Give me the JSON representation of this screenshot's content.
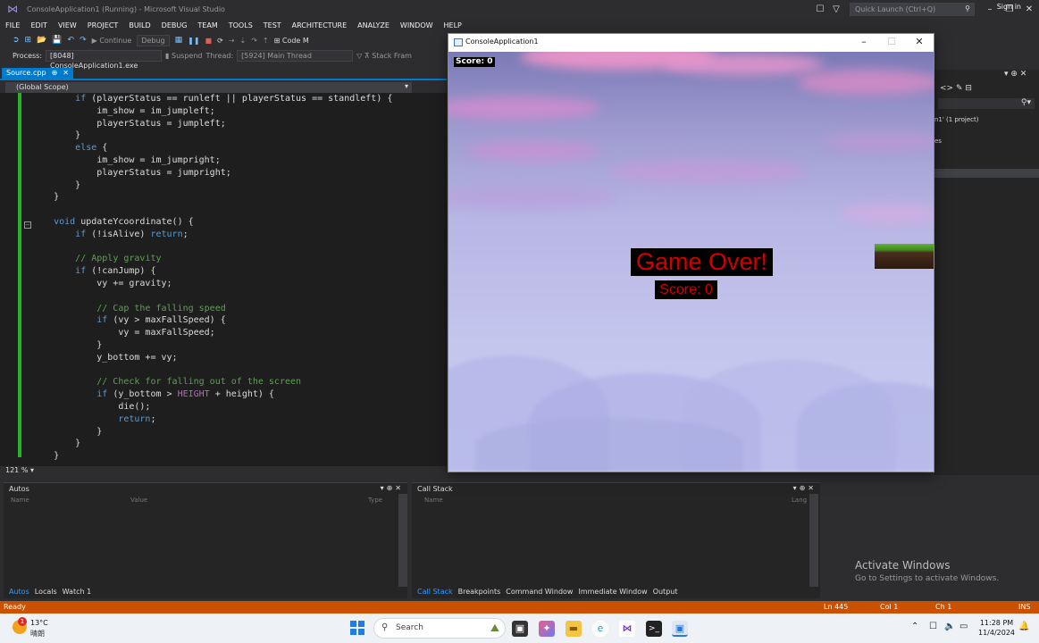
{
  "vs": {
    "title": "ConsoleApplication1 (Running) - Microsoft Visual Studio",
    "quick_launch_placeholder": "Quick Launch (Ctrl+Q)",
    "sign_in": "Sign in",
    "menu": [
      "FILE",
      "EDIT",
      "VIEW",
      "PROJECT",
      "BUILD",
      "DEBUG",
      "TEAM",
      "TOOLS",
      "TEST",
      "ARCHITECTURE",
      "ANALYZE",
      "WINDOW",
      "HELP"
    ],
    "toolbar": {
      "continue_label": "Continue",
      "config": "Debug",
      "code_map": "Code M"
    },
    "toolbar2": {
      "process_label": "Process:",
      "process_value": "[8048] ConsoleApplication1.exe",
      "suspend_label": "Suspend",
      "thread_label": "Thread:",
      "thread_value": "[5924] Main Thread",
      "stack_frame": "Stack Fram"
    },
    "doc_tab": "Source.cpp",
    "scope": "(Global Scope)",
    "zoom": "121 %"
  },
  "code_lines": [
    [
      {
        "t": "        "
      },
      {
        "t": "if",
        "c": "kw"
      },
      {
        "t": " (playerStatus == runleft || playerStatus == standleft) {"
      }
    ],
    [
      {
        "t": "            im_show = im_jumpleft;"
      }
    ],
    [
      {
        "t": "            playerStatus = jumpleft;"
      }
    ],
    [
      {
        "t": "        }"
      }
    ],
    [
      {
        "t": "        "
      },
      {
        "t": "else",
        "c": "kw"
      },
      {
        "t": " {"
      }
    ],
    [
      {
        "t": "            im_show = im_jumpright;"
      }
    ],
    [
      {
        "t": "            playerStatus = jumpright;"
      }
    ],
    [
      {
        "t": "        }"
      }
    ],
    [
      {
        "t": "    }"
      }
    ],
    [
      {
        "t": ""
      }
    ],
    [
      {
        "t": "    "
      },
      {
        "t": "void",
        "c": "kw"
      },
      {
        "t": " updateYcoordinate() {"
      }
    ],
    [
      {
        "t": "        "
      },
      {
        "t": "if",
        "c": "kw"
      },
      {
        "t": " (!isAlive) "
      },
      {
        "t": "return",
        "c": "kw"
      },
      {
        "t": ";"
      }
    ],
    [
      {
        "t": ""
      }
    ],
    [
      {
        "t": "        "
      },
      {
        "t": "// Apply gravity",
        "c": "cm"
      }
    ],
    [
      {
        "t": "        "
      },
      {
        "t": "if",
        "c": "kw"
      },
      {
        "t": " (!canJump) {"
      }
    ],
    [
      {
        "t": "            vy += gravity;"
      }
    ],
    [
      {
        "t": ""
      }
    ],
    [
      {
        "t": "            "
      },
      {
        "t": "// Cap the falling speed",
        "c": "cm"
      }
    ],
    [
      {
        "t": "            "
      },
      {
        "t": "if",
        "c": "kw"
      },
      {
        "t": " (vy > maxFallSpeed) {"
      }
    ],
    [
      {
        "t": "                vy = maxFallSpeed;"
      }
    ],
    [
      {
        "t": "            }"
      }
    ],
    [
      {
        "t": "            y_bottom += vy;"
      }
    ],
    [
      {
        "t": ""
      }
    ],
    [
      {
        "t": "            "
      },
      {
        "t": "// Check for falling out of the screen",
        "c": "cm"
      }
    ],
    [
      {
        "t": "            "
      },
      {
        "t": "if",
        "c": "kw"
      },
      {
        "t": " (y_bottom > "
      },
      {
        "t": "HEIGHT",
        "c": "mc"
      },
      {
        "t": " + height) {"
      }
    ],
    [
      {
        "t": "                die();"
      }
    ],
    [
      {
        "t": "                "
      },
      {
        "t": "return",
        "c": "kw"
      },
      {
        "t": ";"
      }
    ],
    [
      {
        "t": "            }"
      }
    ],
    [
      {
        "t": "        }"
      }
    ],
    [
      {
        "t": "    }"
      }
    ]
  ],
  "solution_explorer": {
    "line1": "n1' (1 project)",
    "line2": "es"
  },
  "autos": {
    "title": "Autos",
    "col_name": "Name",
    "col_value": "Value",
    "col_type": "Type",
    "tabs": [
      "Autos",
      "Locals",
      "Watch 1"
    ]
  },
  "callstack": {
    "title": "Call Stack",
    "col_name": "Name",
    "col_lang": "Lang",
    "tabs": [
      "Call Stack",
      "Breakpoints",
      "Command Window",
      "Immediate Window",
      "Output"
    ]
  },
  "activate": {
    "title": "Activate Windows",
    "subtitle": "Go to Settings to activate Windows."
  },
  "status": {
    "ready": "Ready",
    "ln": "Ln 445",
    "col": "Col 1",
    "ch": "Ch 1",
    "ins": "INS"
  },
  "game": {
    "window_title": "ConsoleApplication1",
    "score_top": "Score: 0",
    "game_over": "Game Over!",
    "score_mid": "Score: 0"
  },
  "taskbar": {
    "weather_badge": "1",
    "temp": "13°C",
    "weather_desc": "晴朗",
    "search_label": "Search",
    "time": "11:28 PM",
    "date": "11/4/2024"
  },
  "colors": {
    "accent": "#007acc",
    "status_bar": "#ca5100",
    "game_over_text": "#d00000"
  }
}
